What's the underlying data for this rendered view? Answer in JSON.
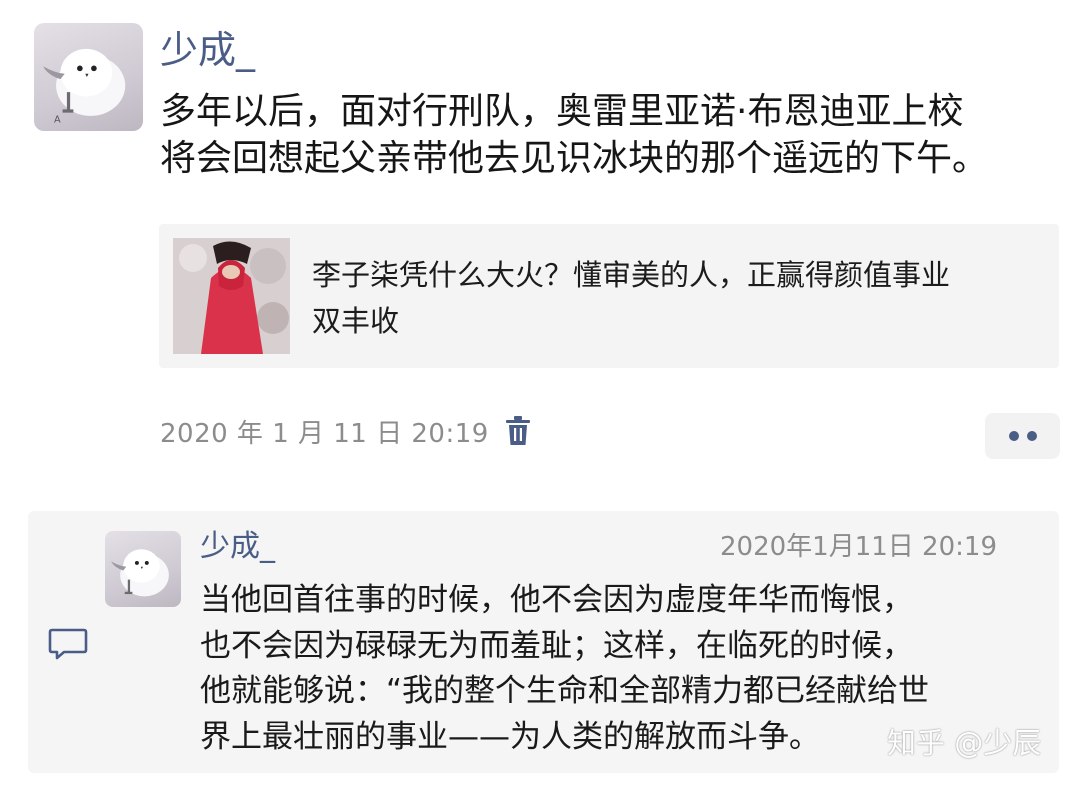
{
  "post": {
    "author": "少成_",
    "text_lines": [
      "多年以后，面对行刑队，奥雷里亚诺·布恩迪亚上校",
      "将会回想起父亲带他去见识冰块的那个遥远的下午。"
    ],
    "link_card": {
      "title_lines": [
        "李子柒凭什么大火？懂审美的人，正赢得颜值事业",
        "双丰收"
      ]
    },
    "timestamp": "2020 年 1 月 11 日 20:19"
  },
  "reply": {
    "author": "少成_",
    "timestamp": "2020年1月11日 20:19",
    "text_lines": [
      "当他回首往事的时候，他不会因为虚度年华而悔恨，",
      "也不会因为碌碌无为而羞耻；这样，在临死的时候，",
      "他就能够说：“我的整个生命和全部精力都已经献给世",
      "界上最壮丽的事业——为人类的解放而斗争。"
    ]
  },
  "watermark": "知乎 @少辰",
  "icons": {
    "delete": "trash-icon",
    "more": "more-dots-icon",
    "comment": "comment-icon"
  },
  "colors": {
    "author_name": "#4a5d86",
    "meta_text": "#8c8c8c",
    "card_background": "#f4f4f4",
    "reply_background": "#f5f5f5"
  }
}
